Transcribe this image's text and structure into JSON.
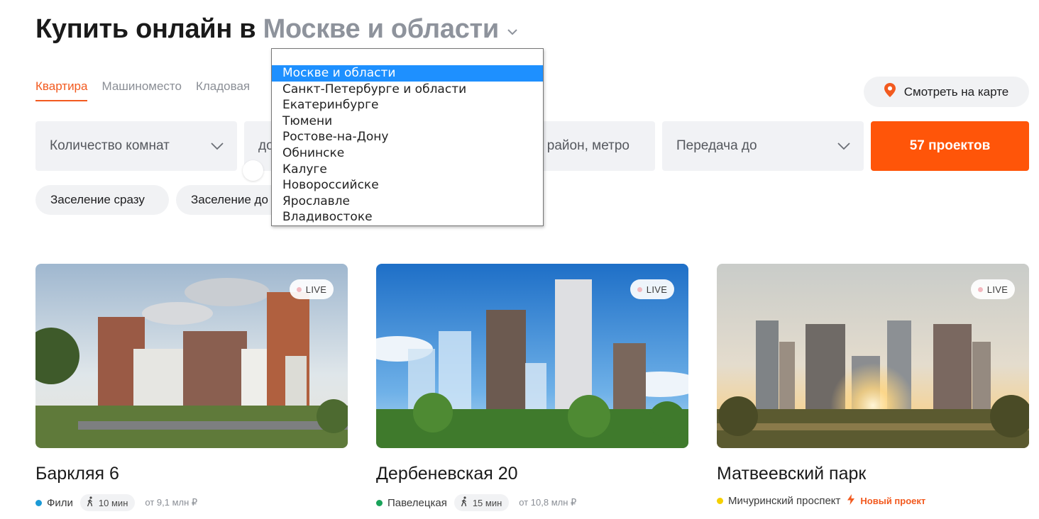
{
  "header": {
    "title_prefix": "Купить онлайн в",
    "city": "Москве и области"
  },
  "tabs": [
    {
      "label": "Квартира",
      "active": true
    },
    {
      "label": "Машиноместо",
      "active": false
    },
    {
      "label": "Кладовая",
      "active": false
    }
  ],
  "map_button": {
    "label": "Смотреть на карте",
    "icon": "map-pin-icon"
  },
  "filters": {
    "rooms": "Количество комнат",
    "price_prefix": "до",
    "location": "район, метро",
    "handover": "Передача до"
  },
  "search_button": {
    "label": "57 проектов"
  },
  "chips": [
    "Заселение сразу",
    "Заселение до"
  ],
  "city_dropdown": {
    "selected": "Москве и области",
    "options": [
      "Москве и области",
      "Санкт-Петербурге и области",
      "Екатеринбурге",
      "Тюмени",
      "Ростове-на-Дону",
      "Обнинске",
      "Калуге",
      "Новороссийске",
      "Ярославле",
      "Владивостоке"
    ]
  },
  "projects": [
    {
      "name": "Баркляя 6",
      "metro": "Фили",
      "metro_color": "#1c9ad6",
      "walk": "10 мин",
      "price": "от 9,1 млн ₽",
      "badge": "LIVE"
    },
    {
      "name": "Дербеневская 20",
      "metro": "Павелецкая",
      "metro_color": "#1aa35a",
      "walk": "15 мин",
      "price": "от 10,8 млн ₽",
      "badge": "LIVE"
    },
    {
      "name": "Матвеевский парк",
      "metro": "Мичуринский проспект",
      "metro_color": "#f5d000",
      "tag": "Новый проект",
      "badge": "LIVE"
    }
  ],
  "colors": {
    "accent": "#ff5509",
    "dropdown_highlight": "#1e90ff",
    "chip_bg": "#f1f2f4"
  }
}
